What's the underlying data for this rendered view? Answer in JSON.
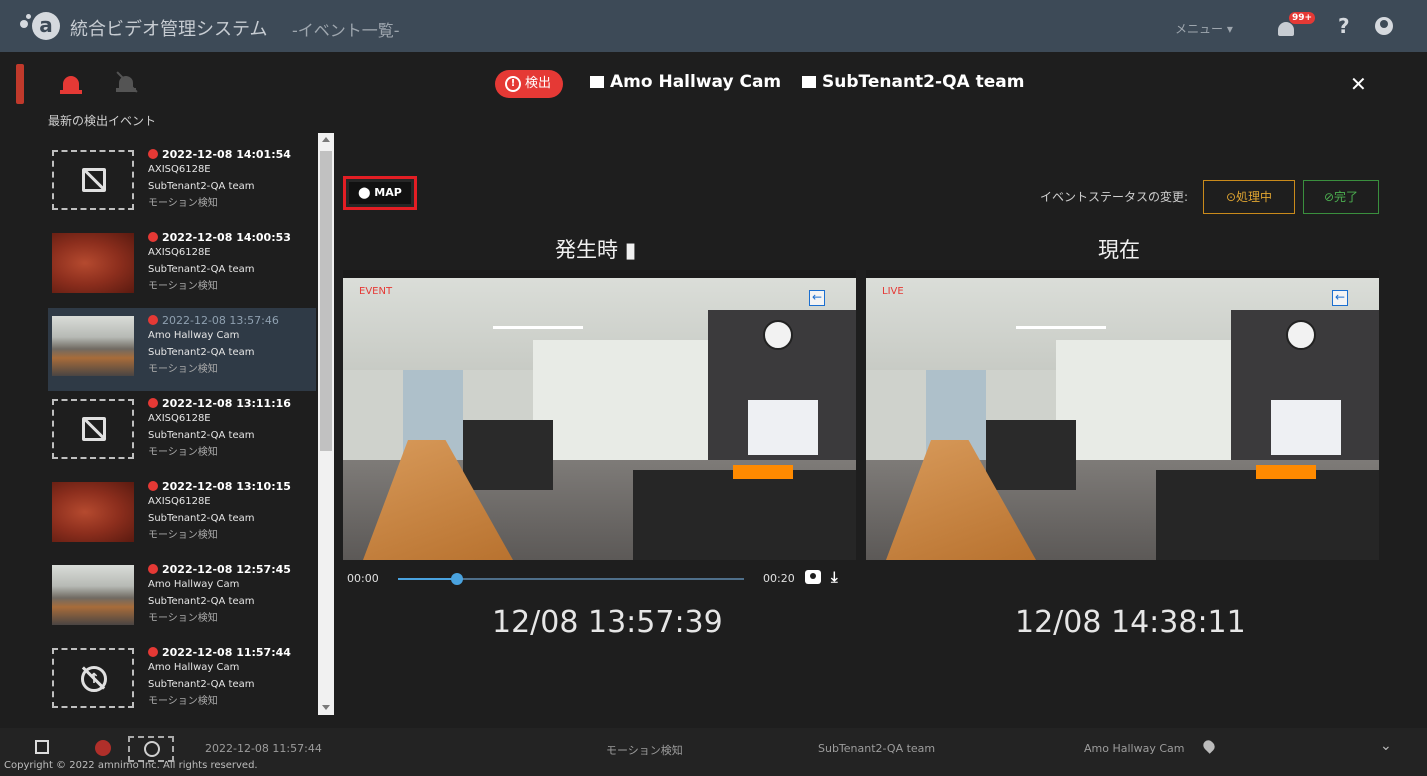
{
  "header": {
    "logo": "a",
    "app_title": "統合ビデオ管理システム",
    "page_subtitle": "-イベント一覧-",
    "menu_label": "メニュー ▾",
    "notifications_badge": "99+",
    "help": "?"
  },
  "sidebar": {
    "title": "最新の検出イベント",
    "events": [
      {
        "timestamp": "2022-12-08 14:01:54",
        "camera": "AXISQ6128E",
        "tenant": "SubTenant2-QA team",
        "type": "モーション検知",
        "thumbnail": "no-image-icon",
        "selected": false
      },
      {
        "timestamp": "2022-12-08 14:00:53",
        "camera": "AXISQ6128E",
        "tenant": "SubTenant2-QA team",
        "type": "モーション検知",
        "thumbnail": "motion-thumbnail",
        "selected": false
      },
      {
        "timestamp": "2022-12-08 13:57:46",
        "camera": "Amo Hallway Cam",
        "tenant": "SubTenant2-QA team",
        "type": "モーション検知",
        "thumbnail": "hallway-thumbnail",
        "selected": true
      },
      {
        "timestamp": "2022-12-08 13:11:16",
        "camera": "AXISQ6128E",
        "tenant": "SubTenant2-QA team",
        "type": "モーション検知",
        "thumbnail": "no-image-icon",
        "selected": false
      },
      {
        "timestamp": "2022-12-08 13:10:15",
        "camera": "AXISQ6128E",
        "tenant": "SubTenant2-QA team",
        "type": "モーション検知",
        "thumbnail": "motion-thumbnail",
        "selected": false
      },
      {
        "timestamp": "2022-12-08 12:57:45",
        "camera": "Amo Hallway Cam",
        "tenant": "SubTenant2-QA team",
        "type": "モーション検知",
        "thumbnail": "hallway-thumbnail",
        "selected": false
      },
      {
        "timestamp": "2022-12-08 11:57:44",
        "camera": "Amo Hallway Cam",
        "tenant": "SubTenant2-QA team",
        "type": "モーション検知",
        "thumbnail": "upload-icon",
        "selected": false
      }
    ]
  },
  "detail": {
    "badge": "検出",
    "camera": "Amo Hallway Cam",
    "tenant": "SubTenant2-QA team",
    "map_label": "MAP",
    "status_label": "イベントステータスの変更:",
    "processing_label": "⊙処理中",
    "done_label": "⊘完了",
    "occurred_label": "発生時",
    "current_label": "現在",
    "event_tag": "EVENT",
    "live_tag": "LIVE",
    "player": {
      "start": "00:00",
      "end": "00:20",
      "progress_fraction": 0.17
    },
    "occurred_time": "12/08 13:57:39",
    "current_time": "12/08 14:38:11"
  },
  "footer": {
    "timestamp": "2022-12-08 11:57:44",
    "type": "モーション検知",
    "tenant": "SubTenant2-QA team",
    "camera": "Amo Hallway Cam",
    "copyright": "Copyright © 2022 amnimo Inc. All rights reserved."
  },
  "colors": {
    "accent_red": "#e53935",
    "processing": "#e0a531",
    "done": "#4caf50",
    "topbar": "#3d4a57"
  }
}
